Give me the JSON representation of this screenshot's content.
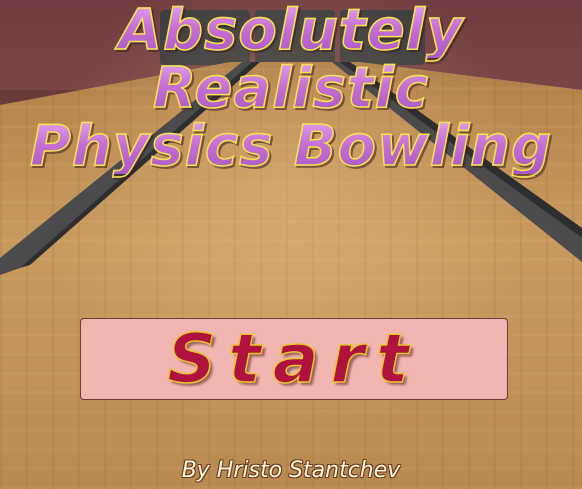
{
  "title": {
    "line1": "Absolutely",
    "line2": "Realistic",
    "line3": "Physics Bowling"
  },
  "start_button": {
    "label": "Start"
  },
  "credit": "By Hristo Stantchev",
  "colors": {
    "wall": "#6e3c3e",
    "lane_wood": "#c99a5e",
    "gutter": "#4a4a4a",
    "title_fill": "#c66fd4",
    "title_outline": "#f2e64a",
    "button_bg": "#f1b6b2",
    "button_text": "#b0123f"
  }
}
